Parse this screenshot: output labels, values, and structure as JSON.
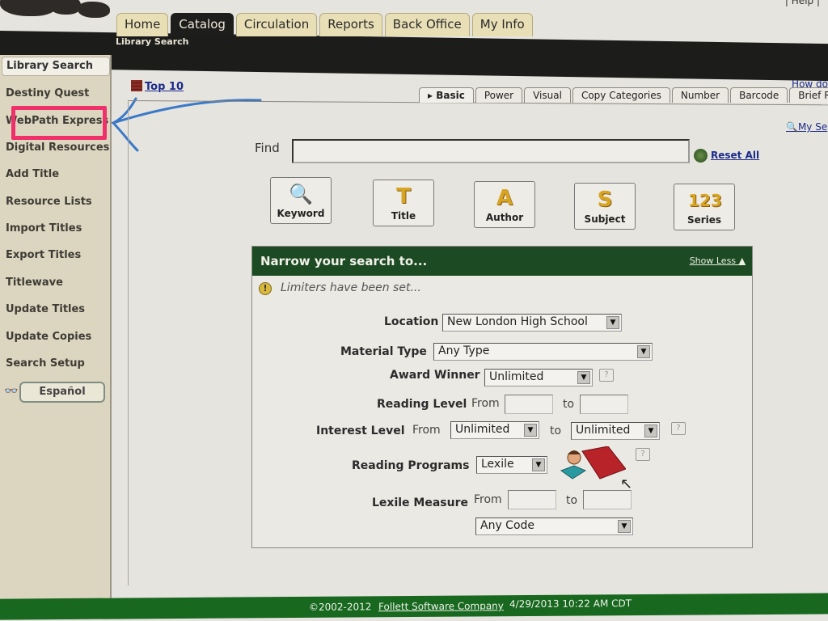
{
  "header": {
    "utility_links": [
      "Help"
    ],
    "top_tabs": [
      {
        "label": "Home",
        "active": false
      },
      {
        "label": "Catalog",
        "active": true
      },
      {
        "label": "Circulation",
        "active": false
      },
      {
        "label": "Reports",
        "active": false
      },
      {
        "label": "Back Office",
        "active": false
      },
      {
        "label": "My Info",
        "active": false
      }
    ],
    "subnav_label": "Library Search"
  },
  "sidebar": {
    "active_item": "Library Search",
    "items": [
      {
        "label": "Destiny Quest"
      },
      {
        "label": "WebPath Express"
      },
      {
        "label": "Digital Resources"
      },
      {
        "label": "Add Title"
      },
      {
        "label": "Resource Lists"
      },
      {
        "label": "Import Titles"
      },
      {
        "label": "Export Titles"
      },
      {
        "label": "Titlewave"
      },
      {
        "label": "Update Titles"
      },
      {
        "label": "Update Copies"
      },
      {
        "label": "Search Setup"
      }
    ],
    "language_button": "Español",
    "annotation": {
      "highlighted_item": "WebPath Express",
      "highlight_color": "#f0306a",
      "arrow_color": "#3a78c8"
    }
  },
  "main": {
    "top10_link": "Top 10",
    "help_link": "How do",
    "my_searches_link": "My Se",
    "search_tabs": [
      {
        "label": "Basic",
        "active": true
      },
      {
        "label": "Power",
        "active": false
      },
      {
        "label": "Visual",
        "active": false
      },
      {
        "label": "Copy Categories",
        "active": false
      },
      {
        "label": "Number",
        "active": false
      },
      {
        "label": "Barcode",
        "active": false
      },
      {
        "label": "Brief Re",
        "active": false
      }
    ],
    "find": {
      "label": "Find",
      "value": "",
      "reset_label": "Reset All"
    },
    "search_buttons": [
      {
        "label": "Keyword",
        "icon": "magnifier-lightning-icon",
        "glyph": "🔍"
      },
      {
        "label": "Title",
        "icon": "title-book-icon",
        "glyph": "T"
      },
      {
        "label": "Author",
        "icon": "author-pen-icon",
        "glyph": "A"
      },
      {
        "label": "Subject",
        "icon": "subject-globe-icon",
        "glyph": "S"
      },
      {
        "label": "Series",
        "icon": "series-123-icon",
        "glyph": "123"
      }
    ],
    "narrow": {
      "title": "Narrow your search to...",
      "show_less": "Show Less",
      "notice": "Limiters have been set...",
      "location": {
        "label": "Location",
        "value": "New London High School"
      },
      "material_type": {
        "label": "Material Type",
        "value": "Any Type"
      },
      "award_winner": {
        "label": "Award Winner",
        "value": "Unlimited"
      },
      "reading_level": {
        "label": "Reading Level",
        "from_label": "From",
        "to_label": "to",
        "from_value": "",
        "to_value": ""
      },
      "interest_level": {
        "label": "Interest Level",
        "from_label": "From",
        "to_label": "to",
        "from_value": "Unlimited",
        "to_value": "Unlimited"
      },
      "reading_programs": {
        "label": "Reading Programs",
        "value": "Lexile"
      },
      "lexile_measure": {
        "label": "Lexile Measure",
        "from_label": "From",
        "to_label": "to",
        "from_value": "",
        "to_value": "",
        "code_value": "Any Code"
      },
      "help_glyph": "?"
    }
  },
  "footer": {
    "copyright": "©2002-2012",
    "company": "Follett Software Company",
    "timestamp": "4/29/2013 10:22 AM CDT"
  }
}
